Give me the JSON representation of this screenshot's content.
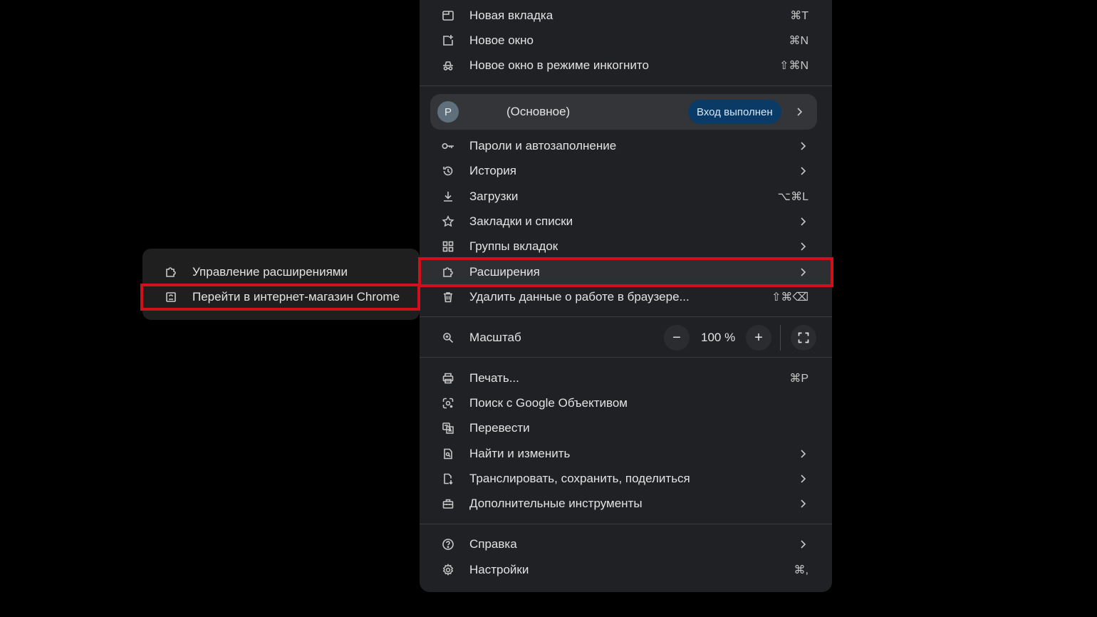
{
  "menu": {
    "items_top": [
      {
        "label": "Новая вкладка",
        "shortcut": "⌘T",
        "icon": "new-tab-icon"
      },
      {
        "label": "Новое окно",
        "shortcut": "⌘N",
        "icon": "new-window-icon"
      },
      {
        "label": "Новое окно в режиме инкогнито",
        "shortcut": "⇧⌘N",
        "icon": "incognito-icon"
      }
    ],
    "profile": {
      "avatar_letter": "P",
      "name": "(Основное)",
      "status": "Вход выполнен"
    },
    "items_mid": [
      {
        "label": "Пароли и автозаполнение",
        "icon": "key-icon"
      },
      {
        "label": "История",
        "icon": "history-icon"
      },
      {
        "label": "Загрузки",
        "shortcut": "⌥⌘L",
        "icon": "download-icon"
      },
      {
        "label": "Закладки и списки",
        "icon": "star-icon"
      },
      {
        "label": "Группы вкладок",
        "icon": "grid-icon"
      },
      {
        "label": "Расширения",
        "icon": "puzzle-icon"
      },
      {
        "label": "Удалить данные о работе в браузере...",
        "shortcut": "⇧⌘⌫",
        "icon": "trash-icon"
      }
    ],
    "zoom": {
      "label": "Масштаб",
      "minus": "−",
      "value": "100 %",
      "plus": "+"
    },
    "items_tools": [
      {
        "label": "Печать...",
        "shortcut": "⌘P",
        "icon": "print-icon"
      },
      {
        "label": "Поиск с Google Объективом",
        "icon": "lens-icon"
      },
      {
        "label": "Перевести",
        "icon": "translate-icon"
      },
      {
        "label": "Найти и изменить",
        "icon": "find-icon"
      },
      {
        "label": "Транслировать, сохранить, поделиться",
        "icon": "cast-icon"
      },
      {
        "label": "Дополнительные инструменты",
        "icon": "toolbox-icon"
      }
    ],
    "items_bottom": [
      {
        "label": "Справка",
        "icon": "help-icon"
      },
      {
        "label": "Настройки",
        "shortcut": "⌘,",
        "icon": "gear-icon"
      }
    ]
  },
  "submenu": {
    "items": [
      {
        "label": "Управление расширениями",
        "icon": "puzzle-icon"
      },
      {
        "label": "Перейти в интернет-магазин Chrome",
        "icon": "store-icon"
      }
    ]
  },
  "colors": {
    "background": "#000000",
    "menu_bg": "#202124",
    "highlight_border": "#d0101a",
    "signed_in_badge": "#0a3b66"
  }
}
